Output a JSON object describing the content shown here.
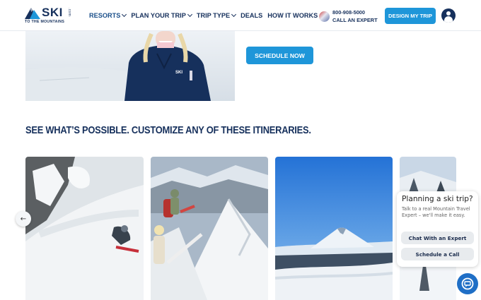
{
  "brand": {
    "name": "SKI",
    "suffix": ".com",
    "tagline": "TO THE MOUNTAINS",
    "navy": "#16305c",
    "accent": "#1e96d9"
  },
  "nav": {
    "items": [
      {
        "label": "RESORTS",
        "has_dropdown": true
      },
      {
        "label": "PLAN YOUR TRIP",
        "has_dropdown": true
      },
      {
        "label": "TRIP TYPE",
        "has_dropdown": true
      },
      {
        "label": "DEALS",
        "has_dropdown": false
      },
      {
        "label": "HOW IT WORKS",
        "has_dropdown": false
      }
    ]
  },
  "header": {
    "phone": "800-908-5000",
    "phone_caption": "CALL AN EXPERT",
    "design_button": "DESIGN MY TRIP",
    "account_icon": "user-circle-icon"
  },
  "hero": {
    "schedule_button": "SCHEDULE NOW"
  },
  "itineraries": {
    "title": "SEE WHAT’S POSSIBLE. CUSTOMIZE ANY OF THESE ITINERARIES.",
    "prev_icon": "arrow-left-icon"
  },
  "chat": {
    "title": "Planning a ski trip?",
    "subtitle": "Talk to a real Mountain Travel Expert – we'll make it easy.",
    "chat_button": "Chat With an Expert",
    "call_button": "Schedule a Call",
    "fab_icon": "chat-bubble-icon",
    "fab_color": "#1f6fc6"
  }
}
